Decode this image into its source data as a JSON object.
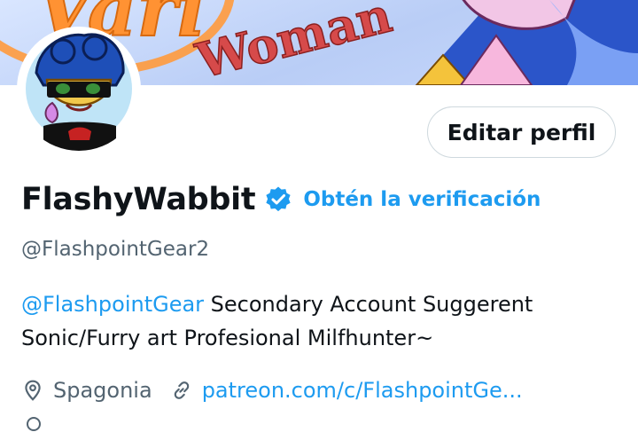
{
  "banner": {
    "text_line_1": "Vari",
    "text_line_2": "Woman"
  },
  "profile": {
    "display_name": "FlashyWabbit",
    "get_verified_label": "Obtén la verificación",
    "handle": "@FlashpointGear2",
    "edit_button_label": "Editar perfil",
    "bio": {
      "mention": "@FlashpointGear",
      "text_1": " Secondary Account  Suggerent",
      "text_2": "Sonic/Furry art  Profesional Milfhunter~"
    },
    "location": "Spagonia",
    "website": "patreon.com/c/FlashpointGe..."
  },
  "icons": {
    "verified": "verified-badge-icon",
    "location": "location-pin-icon",
    "link": "link-icon"
  },
  "colors": {
    "accent": "#1d9bf0",
    "secondary_text": "#536471",
    "primary_text": "#0f1419",
    "border": "#cfd9de"
  }
}
